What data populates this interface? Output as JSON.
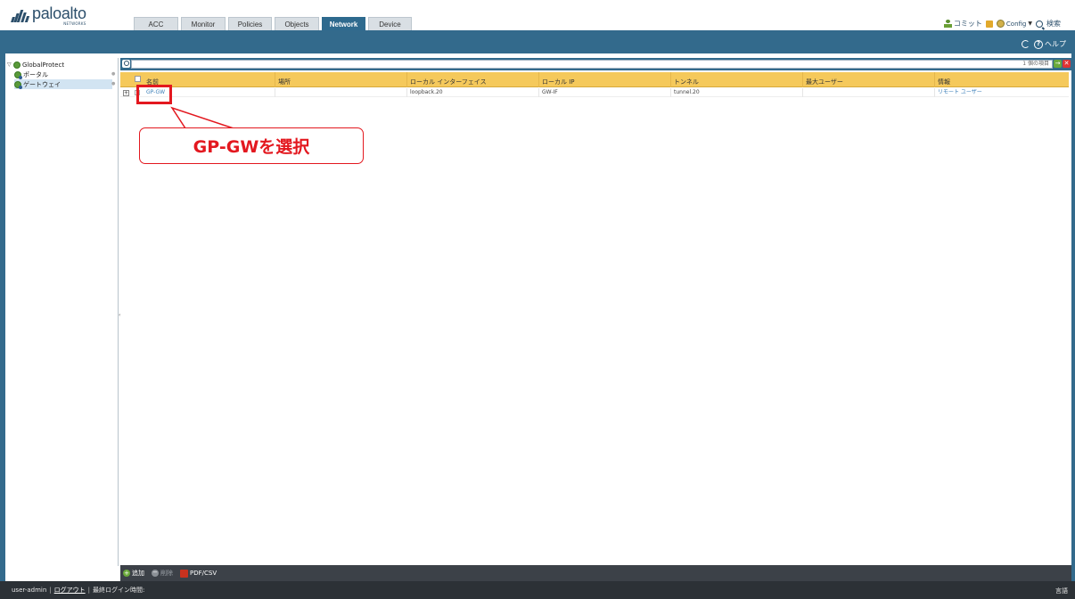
{
  "header": {
    "logo_name": "paloalto",
    "logo_sub": "NETWORKS",
    "tabs": [
      {
        "label": "ACC"
      },
      {
        "label": "Monitor"
      },
      {
        "label": "Policies"
      },
      {
        "label": "Objects"
      },
      {
        "label": "Network",
        "active": true
      },
      {
        "label": "Device"
      }
    ],
    "commit_label": "コミット",
    "config_label": "Config",
    "search_label": "検索",
    "help_label": "ヘルプ"
  },
  "tree": {
    "root_label": "GlobalProtect",
    "items": [
      {
        "label": "ポータル"
      },
      {
        "label": "ゲートウェイ",
        "selected": true
      }
    ]
  },
  "filter": {
    "count_text": "1 個の項目"
  },
  "grid": {
    "columns": [
      "名前",
      "場所",
      "ローカル インターフェイス",
      "ローカル IP",
      "トンネル",
      "最大ユーザー",
      "情報"
    ],
    "rows": [
      {
        "name": "GP-GW",
        "location": "",
        "local_interface": "loopback.20",
        "local_ip": "GW-IF",
        "tunnel": "tunnel.20",
        "max_users": "",
        "info": "リモート ユーザー"
      }
    ]
  },
  "annotation": {
    "callout_text": "GP-GWを選択",
    "color": "#e3181f"
  },
  "bottom_toolbar": {
    "add_label": "追加",
    "delete_label": "削除",
    "pdf_label": "PDF/CSV"
  },
  "status": {
    "user": "user-admin",
    "logout": "ログアウト",
    "last_login": "最終ログイン時間:",
    "language": "言語"
  },
  "colors": {
    "brand_blue": "#336a8c",
    "header_yellow": "#f5c95b",
    "accent_red": "#e3181f"
  }
}
